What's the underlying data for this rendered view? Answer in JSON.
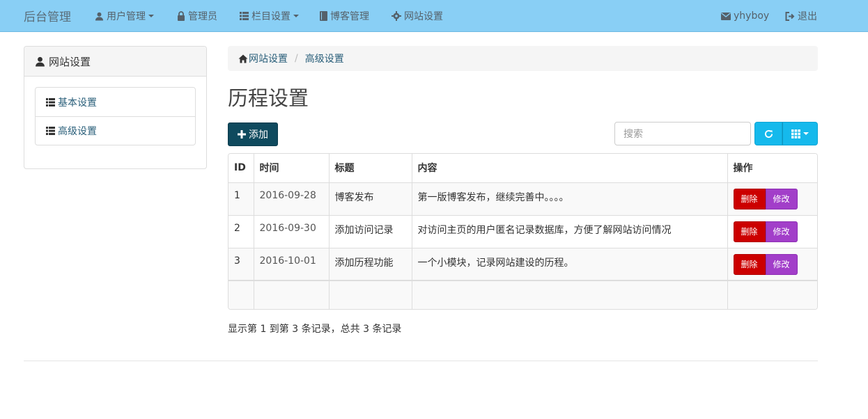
{
  "navbar": {
    "brand": "后台管理",
    "items": [
      {
        "label": "用户管理",
        "icon": "user-icon",
        "dropdown": true
      },
      {
        "label": "管理员",
        "icon": "lock-icon",
        "dropdown": false
      },
      {
        "label": "栏目设置",
        "icon": "list-icon",
        "dropdown": true
      },
      {
        "label": "博客管理",
        "icon": "book-icon",
        "dropdown": false
      },
      {
        "label": "网站设置",
        "icon": "gear-icon",
        "dropdown": false
      }
    ],
    "right": [
      {
        "label": "yhyboy",
        "icon": "envelope-icon"
      },
      {
        "label": "退出",
        "icon": "logout-icon"
      }
    ]
  },
  "sidebar": {
    "title": "网站设置",
    "title_icon": "user-icon",
    "items": [
      {
        "label": "基本设置",
        "icon": "list-icon"
      },
      {
        "label": "高级设置",
        "icon": "list-icon"
      }
    ]
  },
  "breadcrumb": {
    "home_label": "网站设置",
    "current_label": "高级设置",
    "separator": "/"
  },
  "page": {
    "title": "历程设置"
  },
  "toolbar": {
    "add_label": "添加",
    "search_placeholder": "搜索"
  },
  "table": {
    "headers": {
      "id": "ID",
      "time": "时间",
      "title": "标题",
      "content": "内容",
      "actions": "操作"
    },
    "rows": [
      {
        "id": "1",
        "time": "2016-09-28",
        "title": "博客发布",
        "content": "第一版博客发布，继续完善中。。。。",
        "delete_label": "删除",
        "edit_label": "修改"
      },
      {
        "id": "2",
        "time": "2016-09-30",
        "title": "添加访问记录",
        "content": "对访问主页的用户匿名记录数据库，方便了解网站访问情况",
        "delete_label": "删除",
        "edit_label": "修改"
      },
      {
        "id": "3",
        "time": "2016-10-01",
        "title": "添加历程功能",
        "content": "一个小模块，记录网站建设的历程。",
        "delete_label": "删除",
        "edit_label": "修改"
      }
    ]
  },
  "pagination": {
    "info": "显示第 1 到第 3 条记录，总共 3 条记录"
  },
  "colors": {
    "navbar_bg": "#89cff5",
    "add_button": "#0f4a5e",
    "info_button": "#15b9ec",
    "delete_button": "#cc0000",
    "edit_button": "#a23ec9",
    "link": "#2a5f7a"
  }
}
